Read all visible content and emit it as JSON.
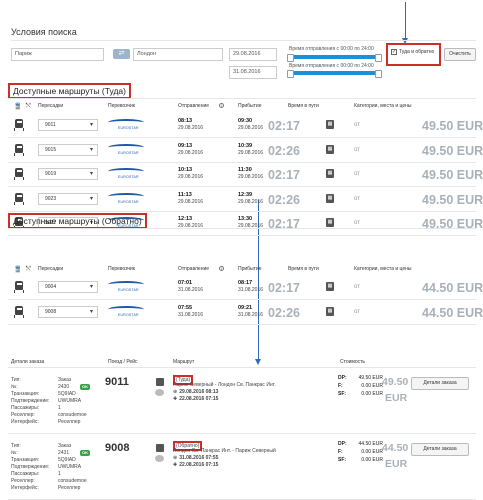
{
  "search": {
    "title": "Условия поиска",
    "from_value": "Париж",
    "to_value": "Лондон",
    "depart_date": "29.08.2016",
    "return_date": "31.08.2016",
    "time_label_1": "Время отправления с 00:00 по 24:00",
    "time_label_2": "Время отправления с 00:00 по 24:00",
    "roundtrip_label": "Туда и обратно",
    "clear_label": "Очистить",
    "swap_icon": "swap-arrows-icon"
  },
  "table_headers": {
    "transfers": "Пересадки",
    "carrier": "Перевозчик",
    "departure": "Отправление",
    "arrival": "Прибытие",
    "travel_time": "Время в пути",
    "categories": "Категории, места и цены"
  },
  "outbound": {
    "title": "Доступные маршруты (Туда)",
    "rows": [
      {
        "train": "9011",
        "carrier": "EUROSTAR",
        "dep_time": "08:13",
        "dep_date": "29.08.2016",
        "arr_time": "09:30",
        "arr_date": "29.08.2016",
        "duration": "02:17",
        "from": "от",
        "price": "49.50 EUR"
      },
      {
        "train": "9015",
        "carrier": "EUROSTAR",
        "dep_time": "09:13",
        "dep_date": "29.08.2016",
        "arr_time": "10:39",
        "arr_date": "29.08.2016",
        "duration": "02:26",
        "from": "от",
        "price": "49.50 EUR"
      },
      {
        "train": "9019",
        "carrier": "EUROSTAR",
        "dep_time": "10:13",
        "dep_date": "29.08.2016",
        "arr_time": "11:30",
        "arr_date": "29.08.2016",
        "duration": "02:17",
        "from": "от",
        "price": "49.50 EUR"
      },
      {
        "train": "9023",
        "carrier": "EUROSTAR",
        "dep_time": "11:13",
        "dep_date": "29.08.2016",
        "arr_time": "12:39",
        "arr_date": "29.08.2016",
        "duration": "02:26",
        "from": "от",
        "price": "49.50 EUR"
      },
      {
        "train": "9027",
        "carrier": "EUROSTAR",
        "dep_time": "12:13",
        "dep_date": "29.08.2016",
        "arr_time": "13:30",
        "arr_date": "29.08.2016",
        "duration": "02:17",
        "from": "от",
        "price": "49.50 EUR"
      }
    ]
  },
  "return_routes": {
    "title": "Доступные маршруты (Обратно)",
    "rows": [
      {
        "train": "9004",
        "carrier": "EUROSTAR",
        "dep_time": "07:01",
        "dep_date": "31.08.2016",
        "arr_time": "08:17",
        "arr_date": "31.08.2016",
        "duration": "02:17",
        "from": "от",
        "price": "44.50 EUR"
      },
      {
        "train": "9008",
        "carrier": "EUROSTAR",
        "dep_time": "07:55",
        "dep_date": "31.08.2016",
        "arr_time": "09:21",
        "arr_date": "31.08.2016",
        "duration": "02:26",
        "from": "от",
        "price": "44.50 EUR"
      }
    ]
  },
  "orders": {
    "headers": {
      "details": "Детали заказа",
      "train": "Поезд / Рейс",
      "route": "Маршрут",
      "cost": "Стоимость"
    },
    "labels": {
      "type": "Тип:",
      "no": "№:",
      "transaction": "Транзакция:",
      "confirmation": "Подтверждение:",
      "passengers": "Пассажиры:",
      "reseller": "Реселлер:",
      "interface": "Интерфейс:"
    },
    "items": [
      {
        "type": "Заказ",
        "no": "2430",
        "status": "OK",
        "transaction": "5Q9IAD",
        "confirmation": "UWUMRA",
        "passengers": "1",
        "reseller": "consudemoe",
        "interface": "Реселлер",
        "train": "9011",
        "direction": "(Туда)",
        "route": "Париж Северный - Лондон Св. Панкрас Инт.",
        "dep": "29.08.2016 08:13",
        "arr": "22.08.2016 07:15",
        "dp_label": "DP:",
        "dp": "49.50 EUR",
        "f_label": "F:",
        "f": "0.00 EUR",
        "sf_label": "SF:",
        "sf": "0.00 EUR",
        "total": "49.50",
        "currency": "EUR",
        "btn": "Детали заказа"
      },
      {
        "type": "Заказ",
        "no": "2431",
        "status": "OK",
        "transaction": "5Q9IAD",
        "confirmation": "UWUMRA",
        "passengers": "1",
        "reseller": "consudemoe",
        "interface": "Реселлер",
        "train": "9008",
        "direction": "(Обратно)",
        "route": "Лондон Св. Панкрас Инт. - Париж Северный",
        "dep": "31.08.2016 07:55",
        "arr": "22.08.2016 07:15",
        "dp_label": "DP:",
        "dp": "44.50 EUR",
        "f_label": "F:",
        "f": "0.00 EUR",
        "sf_label": "SF:",
        "sf": "0.00 EUR",
        "total": "44.50",
        "currency": "EUR",
        "btn": "Детали заказа"
      }
    ]
  },
  "colors": {
    "accent": "#1e90d6",
    "highlight": "#c9302c",
    "arrow": "#2f6bbf",
    "ok": "#3aa24a"
  }
}
